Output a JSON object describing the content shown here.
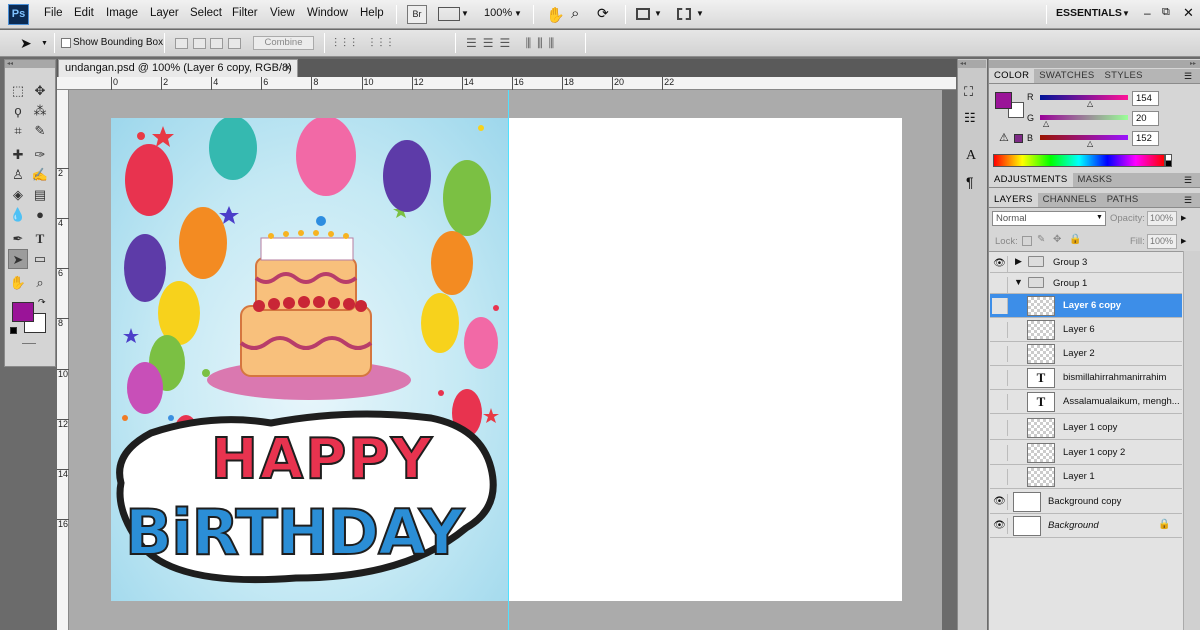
{
  "app": {
    "logo": "Ps"
  },
  "menu": [
    "File",
    "Edit",
    "Image",
    "Layer",
    "Select",
    "Filter",
    "View",
    "Window",
    "Help"
  ],
  "appbar": {
    "bridge": "Br",
    "zoom": "100%",
    "workspace": "ESSENTIALS"
  },
  "options": {
    "show_bounding_box": "Show Bounding Box",
    "combine": "Combine"
  },
  "document": {
    "tab_title": "undangan.psd @ 100% (Layer 6 copy, RGB/8) *",
    "close": "×"
  },
  "ruler": {
    "top": [
      "0",
      "2",
      "4",
      "6",
      "8",
      "10",
      "12",
      "14",
      "16",
      "18",
      "20",
      "22"
    ],
    "left": [
      "2",
      "4",
      "6",
      "8",
      "10",
      "12",
      "14",
      "16"
    ]
  },
  "card": {
    "line1": "HAPPY",
    "line2": "BiRTHDAY"
  },
  "color_panel": {
    "tabs": [
      "COLOR",
      "SWATCHES",
      "STYLES"
    ],
    "r_label": "R",
    "g_label": "G",
    "b_label": "B",
    "r": "154",
    "g": "20",
    "b": "152",
    "foreground": "#9a1498"
  },
  "adjust_panel": {
    "tabs": [
      "ADJUSTMENTS",
      "MASKS"
    ]
  },
  "layers_panel": {
    "tabs": [
      "LAYERS",
      "CHANNELS",
      "PATHS"
    ],
    "blend_mode": "Normal",
    "opacity_label": "Opacity:",
    "opacity": "100%",
    "lock_label": "Lock:",
    "fill_label": "Fill:",
    "fill": "100%",
    "layers": [
      {
        "name": "Group 3"
      },
      {
        "name": "Group 1"
      },
      {
        "name": "Layer 6 copy"
      },
      {
        "name": "Layer 6"
      },
      {
        "name": "Layer 2"
      },
      {
        "name": "bismillahirrahmanirrahim"
      },
      {
        "name": "Assalamualaikum, mengh..."
      },
      {
        "name": "Layer 1 copy"
      },
      {
        "name": "Layer 1 copy 2"
      },
      {
        "name": "Layer 1"
      },
      {
        "name": "Background copy"
      },
      {
        "name": "Background"
      }
    ]
  }
}
